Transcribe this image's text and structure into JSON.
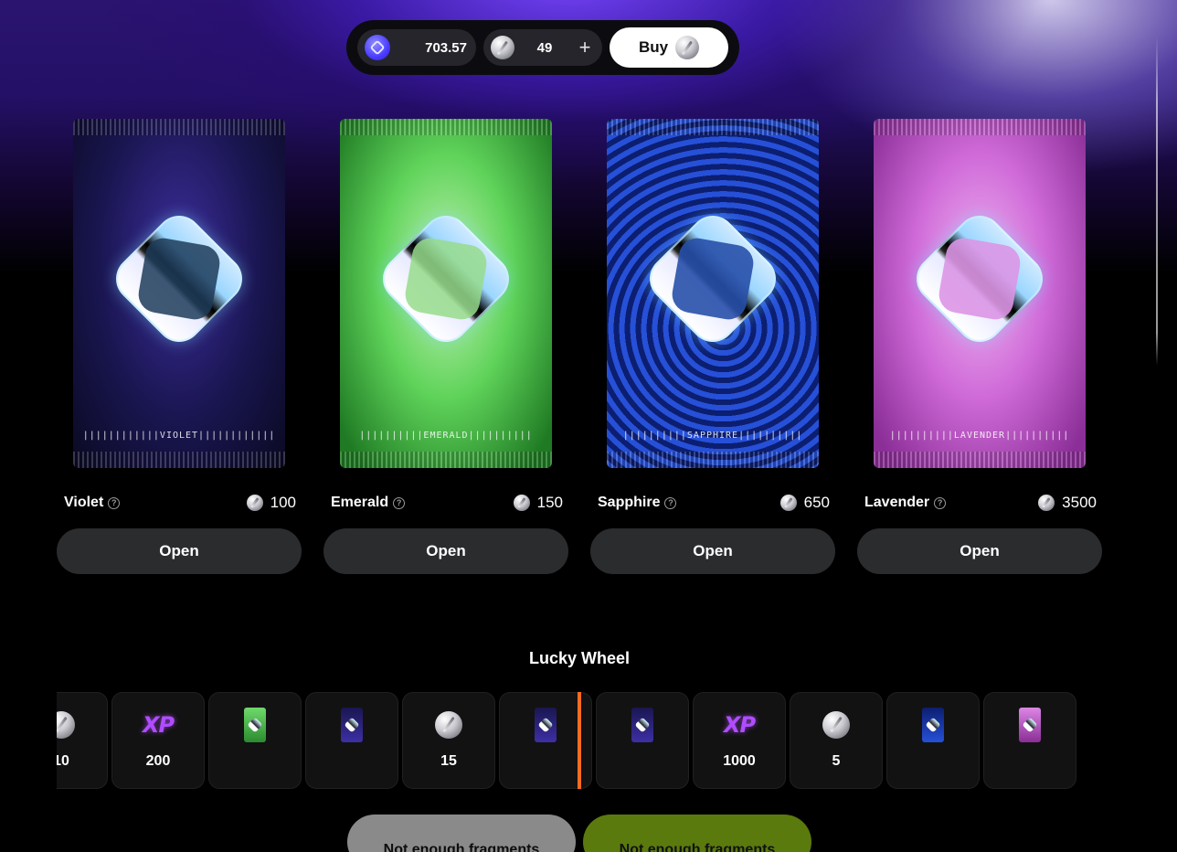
{
  "topbar": {
    "balance": "703.57",
    "fragments": "49",
    "plus_label": "+",
    "buy_label": "Buy"
  },
  "packs": [
    {
      "name": "Violet",
      "price": "100",
      "button": "Open",
      "label": "||||||||||||VIOLET||||||||||||"
    },
    {
      "name": "Emerald",
      "price": "150",
      "button": "Open",
      "label": "||||||||||EMERALD||||||||||"
    },
    {
      "name": "Sapphire",
      "price": "650",
      "button": "Open",
      "label": "||||||||||SAPPHIRE||||||||||"
    },
    {
      "name": "Lavender",
      "price": "3500",
      "button": "Open",
      "label": "||||||||||LAVENDER||||||||||"
    }
  ],
  "wheel": {
    "title": "Lucky Wheel",
    "items": [
      {
        "icon": "fragment-icon",
        "value": "10"
      },
      {
        "icon": "xp-icon",
        "value": "200",
        "icon_text": "XP"
      },
      {
        "icon": "emerald-pack-icon",
        "value": ""
      },
      {
        "icon": "violet-pack-icon",
        "value": ""
      },
      {
        "icon": "fragment-icon",
        "value": "15"
      },
      {
        "icon": "violet-pack-icon",
        "value": ""
      },
      {
        "icon": "violet-pack-icon",
        "value": ""
      },
      {
        "icon": "xp-icon",
        "value": "1000",
        "icon_text": "XP"
      },
      {
        "icon": "fragment-icon",
        "value": "5"
      },
      {
        "icon": "sapphire-pack-icon",
        "value": ""
      },
      {
        "icon": "lavender-pack-icon",
        "value": ""
      }
    ]
  },
  "actions": {
    "primary": "Not enough fragments",
    "secondary": "Not enough fragments"
  },
  "colors": {
    "marker": "#ff6a1f",
    "accent_green": "#5a7a0e",
    "button_grey": "#8a8a8a",
    "xp_purple": "#b04cff"
  }
}
